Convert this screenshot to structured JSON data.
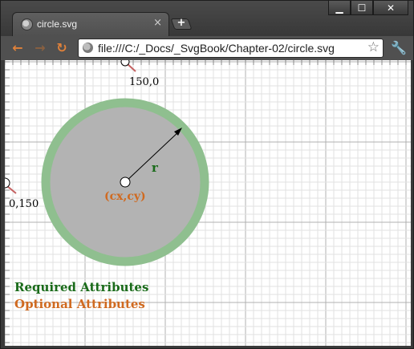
{
  "window": {
    "tab_title": "circle.svg",
    "tab_close": "×",
    "new_tab": "+",
    "minimize": "▁",
    "maximize": "☐",
    "close": "✕"
  },
  "toolbar": {
    "back": "←",
    "forward": "→",
    "reload": "↻",
    "url": "file:///C:/_Docs/_SvgBook/Chapter-02/circle.svg",
    "star": "☆",
    "wrench": "🔧"
  },
  "diagram": {
    "point_top_label": "150,0",
    "point_left_label": "0,150",
    "radius_label": "r",
    "center_label": "(cx,cy)",
    "legend_required": "Required Attributes",
    "legend_optional": "Optional Attributes",
    "colors": {
      "required": "#1a6b1a",
      "optional": "#d06a20",
      "circle_fill": "#b3b3b3",
      "circle_stroke": "#8fbf8f",
      "grid_minor": "#e2e2e2",
      "grid_major": "#b0b0b0",
      "pointer": "#c46060"
    }
  }
}
